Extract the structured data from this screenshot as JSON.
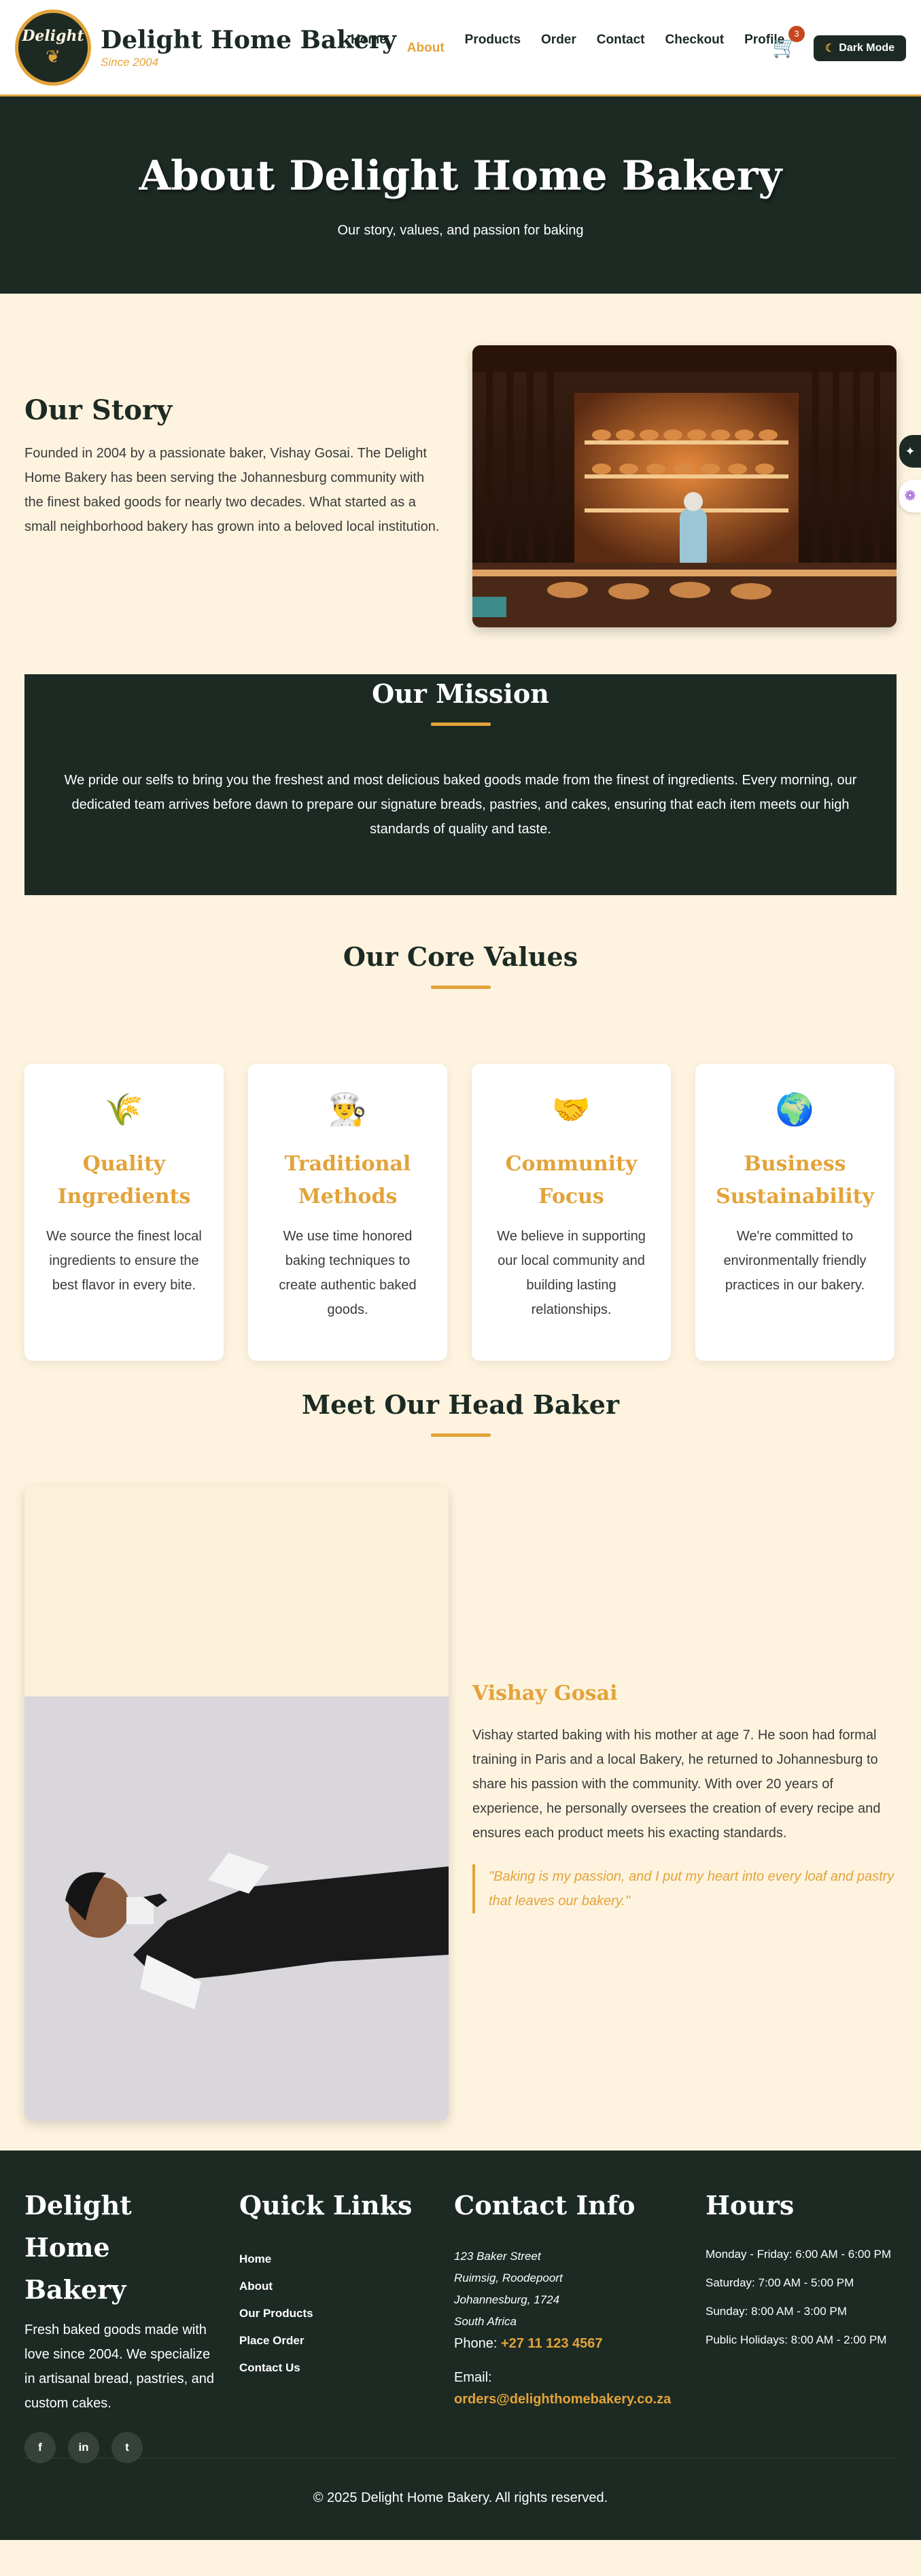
{
  "brand": {
    "logo_text": "Delight",
    "title": "Delight Home Bakery",
    "since": "Since 2004"
  },
  "nav": {
    "items": [
      "Home",
      "About",
      "Products",
      "Order",
      "Contact",
      "Checkout",
      "Profile"
    ],
    "active": "About"
  },
  "cart": {
    "count": "3"
  },
  "dark_mode_label": "Dark Mode",
  "hero": {
    "title": "About Delight Home Bakery",
    "subtitle": "Our story, values, and passion for baking"
  },
  "story": {
    "title": "Our Story",
    "text": "Founded in 2004 by a passionate baker, Vishay Gosai. The Delight Home Bakery has been serving the Johannesburg community with the finest baked goods for nearly two decades. What started as a small neighborhood bakery has grown into a beloved local institution."
  },
  "mission": {
    "title": "Our Mission",
    "text": "We pride our selfs to bring you the freshest and most delicious baked goods made from the finest of ingredients. Every morning, our dedicated team arrives before dawn to prepare our signature breads, pastries, and cakes, ensuring that each item meets our high standards of quality and taste."
  },
  "values": {
    "title": "Our Core Values",
    "cards": [
      {
        "icon": "wheat-icon",
        "glyph": "🌾",
        "title": "Quality Ingredients",
        "text": "We source the finest local ingredients to ensure the best flavor in every bite."
      },
      {
        "icon": "baker-icon",
        "glyph": "👨‍🍳",
        "title": "Traditional Methods",
        "text": "We use time honored baking techniques to create authentic baked goods."
      },
      {
        "icon": "handshake-icon",
        "glyph": "🤝",
        "title": "Community Focus",
        "text": "We believe in supporting our local community and building lasting relationships."
      },
      {
        "icon": "globe-icon",
        "glyph": "🌍",
        "title": "Business Sustainability",
        "text": "We're committed to environmentally friendly practices in our bakery."
      }
    ]
  },
  "baker": {
    "section_title": "Meet Our Head Baker",
    "name": "Vishay Gosai",
    "bio": "Vishay started baking with his mother at age 7. He soon had formal training in Paris and a local Bakery, he returned to Johannesburg to share his passion with the community. With over 20 years of experience, he personally oversees the creation of every recipe and ensures each product meets his exacting standards.",
    "quote": "\"Baking is my passion, and I put my heart into every loaf and pastry that leaves our bakery.\""
  },
  "footer": {
    "about": {
      "title": "Delight Home Bakery",
      "text": "Fresh baked goods made with love since 2004. We specialize in artisanal bread, pastries, and custom cakes.",
      "socials": [
        "f",
        "in",
        "t"
      ]
    },
    "links": {
      "title": "Quick Links",
      "items": [
        "Home",
        "About",
        "Our Products",
        "Place Order",
        "Contact Us"
      ]
    },
    "contact": {
      "title": "Contact Info",
      "address": [
        "123 Baker Street",
        "Ruimsig, Roodepoort",
        "Johannesburg, 1724",
        "South Africa"
      ],
      "phone_label": "Phone: ",
      "phone": "+27 11 123 4567",
      "email_label": "Email:",
      "email": "orders@delighthomebakery.co.za"
    },
    "hours": {
      "title": "Hours",
      "items": [
        "Monday - Friday: 6:00 AM - 6:00 PM",
        "Saturday: 7:00 AM - 5:00 PM",
        "Sunday: 8:00 AM - 3:00 PM",
        "Public Holidays: 8:00 AM - 2:00 PM"
      ]
    },
    "copyright": "© 2025 Delight Home Bakery. All rights reserved."
  },
  "colors": {
    "primary": "#1c2a23",
    "accent": "#e3a33a",
    "background": "#fdf3df"
  }
}
